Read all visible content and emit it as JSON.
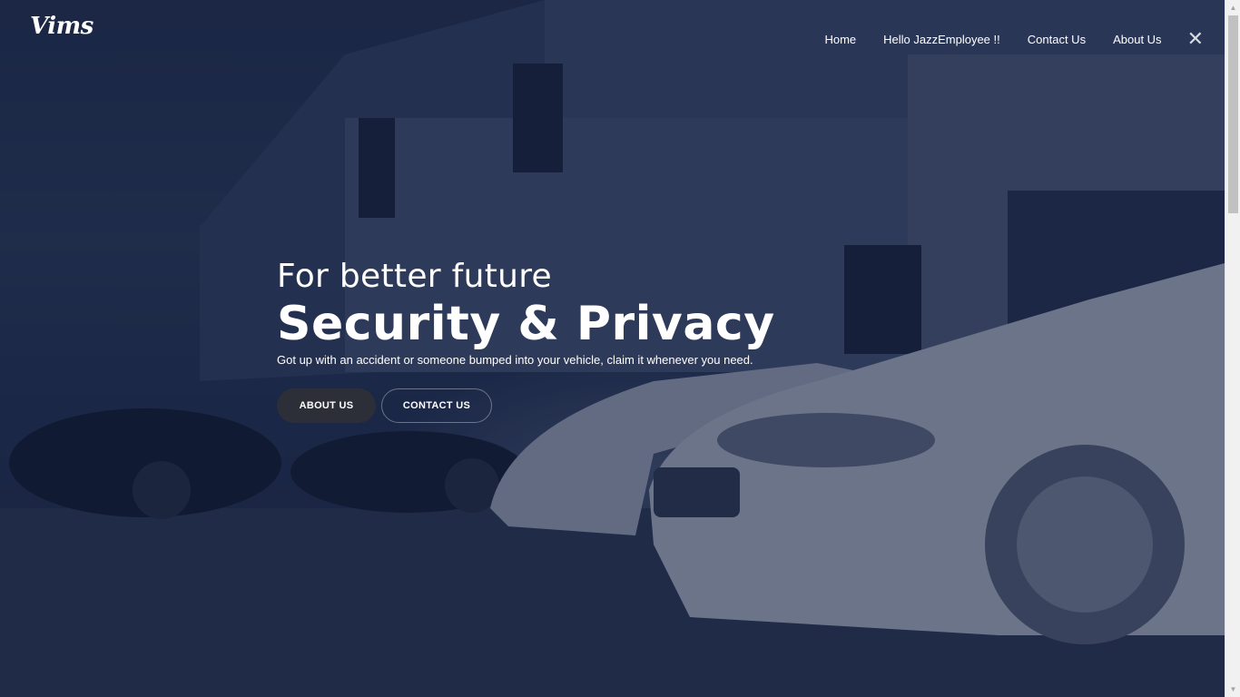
{
  "brand": {
    "logo_text": "Vims"
  },
  "nav": {
    "items": [
      {
        "label": "Home"
      },
      {
        "label": "Hello JazzEmployee !!"
      },
      {
        "label": "Contact Us"
      },
      {
        "label": "About Us"
      }
    ],
    "close_icon": "close-icon"
  },
  "hero": {
    "kicker": "For better future",
    "headline": "Security & Privacy",
    "subtext": "Got up with an accident or someone bumped into your vehicle, claim it whenever you need.",
    "buttons": {
      "about": "ABOUT US",
      "contact": "CONTACT US"
    }
  },
  "colors": {
    "overlay": "#0f1c3c",
    "button_dark": "#2c2f38",
    "text": "#ffffff"
  }
}
